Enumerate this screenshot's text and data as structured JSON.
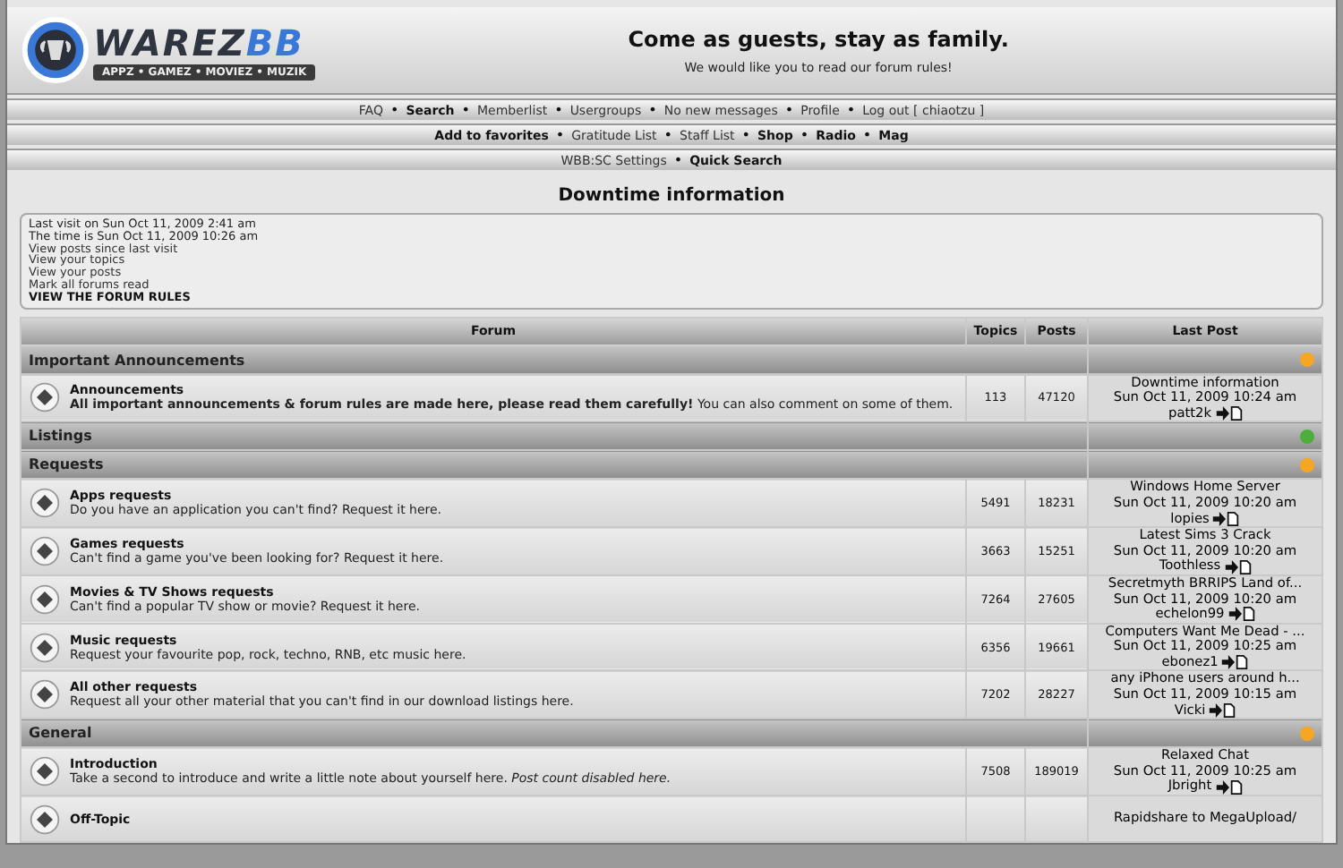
{
  "header": {
    "logo": {
      "word": "WAREZ",
      "word_accent": "BB",
      "tagline": "APPZ • GAMEZ • MOVIEZ • MUZIK"
    },
    "headline": "Come as guests, stay as family.",
    "subline": "We would like you to read our forum rules!"
  },
  "nav_rows": [
    {
      "separator": "•",
      "links": [
        {
          "label": "FAQ",
          "bold": false
        },
        {
          "label": "Search",
          "bold": true
        },
        {
          "label": "Memberlist",
          "bold": false
        },
        {
          "label": "Usergroups",
          "bold": false
        },
        {
          "label": "No new messages",
          "bold": false
        },
        {
          "label": "Profile",
          "bold": false
        },
        {
          "label": "Log out [ chiaotzu ]",
          "bold": false
        }
      ]
    },
    {
      "separator": "•",
      "links": [
        {
          "label": "Add to favorites",
          "bold": true
        },
        {
          "label": "Gratitude List",
          "bold": false
        },
        {
          "label": "Staff List",
          "bold": false
        },
        {
          "label": "Shop",
          "bold": true
        },
        {
          "label": "Radio",
          "bold": true
        },
        {
          "label": "Mag",
          "bold": true
        }
      ]
    },
    {
      "separator": "•",
      "links": [
        {
          "label": "WBB:SC Settings",
          "bold": false
        },
        {
          "label": "Quick Search",
          "bold": true
        }
      ]
    }
  ],
  "page_title": "Downtime information",
  "info_box": [
    {
      "text": "Last visit on Sun Oct 11, 2009 2:41 am",
      "kind": "text"
    },
    {
      "text": "The time is Sun Oct 11, 2009 10:26 am",
      "kind": "text"
    },
    {
      "text": "View posts since last visit",
      "kind": "link"
    },
    {
      "text": "View your topics",
      "kind": "link"
    },
    {
      "text": "View your posts",
      "kind": "link"
    },
    {
      "text": "Mark all forums read",
      "kind": "link"
    },
    {
      "text": "VIEW THE FORUM RULES",
      "kind": "strong-link"
    }
  ],
  "table": {
    "columns": [
      "Forum",
      "Topics",
      "Posts",
      "Last Post"
    ],
    "categories": [
      {
        "name": "Important Announcements",
        "color": "#f5a623",
        "forums": [
          {
            "name": "Announcements",
            "description": "**All important announcements & forum rules are made here, please read them carefully!** You can also comment on some of them.",
            "topics": "113",
            "posts": "47120",
            "last_post": {
              "title": "Downtime information",
              "time": "Sun Oct 11, 2009 10:24 am",
              "author": "patt2k"
            }
          }
        ]
      },
      {
        "name": "Listings",
        "color": "#4caf3a"
      },
      {
        "name": "Requests",
        "color": "#f5a623",
        "forums": [
          {
            "name": "Apps requests",
            "description": "Do you have an application you can't find? Request it here.",
            "topics": "5491",
            "posts": "18231",
            "last_post": {
              "title": "Windows Home Server",
              "time": "Sun Oct 11, 2009 10:20 am",
              "author": "lopies"
            }
          },
          {
            "name": "Games requests",
            "description": "Can't find a game you've been looking for? Request it here.",
            "topics": "3663",
            "posts": "15251",
            "last_post": {
              "title": "Latest Sims 3 Crack",
              "time": "Sun Oct 11, 2009 10:20 am",
              "author": "Toothless"
            }
          },
          {
            "name": "Movies & TV Shows requests",
            "description": "Can't find a popular TV show or movie? Request it here.",
            "topics": "7264",
            "posts": "27605",
            "last_post": {
              "title": "Secretmyth BRRIPS Land of...",
              "time": "Sun Oct 11, 2009 10:20 am",
              "author": "echelon99"
            }
          },
          {
            "name": "Music requests",
            "description": "Request your favourite pop, rock, techno, RNB, etc music here.",
            "topics": "6356",
            "posts": "19661",
            "last_post": {
              "title": "Computers Want Me Dead - ...",
              "time": "Sun Oct 11, 2009 10:25 am",
              "author": "ebonez1"
            }
          },
          {
            "name": "All other requests",
            "description": "Request all your other material that you can't find in our download listings here.",
            "topics": "7202",
            "posts": "28227",
            "last_post": {
              "title": "any iPhone users around h...",
              "time": "Sun Oct 11, 2009 10:15 am",
              "author": "Vicki"
            }
          }
        ]
      },
      {
        "name": "General",
        "color": "#f5a623",
        "forums": [
          {
            "name": "Introduction",
            "description": "Take a second to introduce and write a little note about yourself here. *Post count disabled here.*",
            "topics": "7508",
            "posts": "189019",
            "last_post": {
              "title": "Relaxed Chat",
              "time": "Sun Oct 11, 2009 10:25 am",
              "author": "Jbright"
            }
          },
          {
            "name": "Off-Topic",
            "last_post": {
              "title": "Rapidshare to MegaUpload/"
            }
          }
        ]
      }
    ]
  }
}
